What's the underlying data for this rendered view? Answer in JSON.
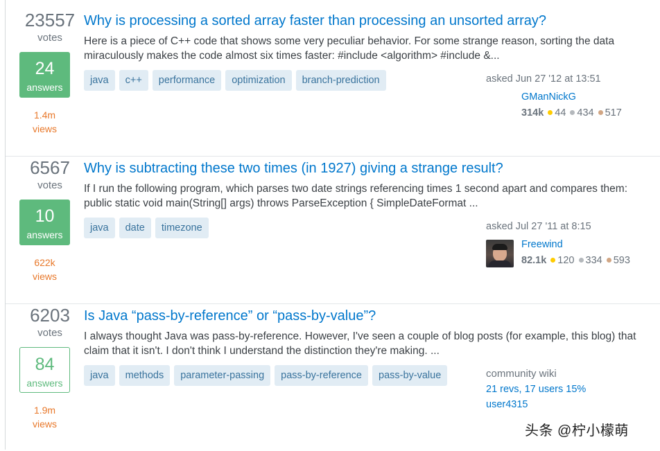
{
  "questions": [
    {
      "votes": "23557",
      "votes_label": "votes",
      "answers": "24",
      "answers_label": "answers",
      "views": "1.4m",
      "views_label": "views",
      "title": "Why is processing a sorted array faster than processing an unsorted array?",
      "excerpt": "Here is a piece of C++ code that shows some very peculiar behavior. For some strange reason, sorting the data miraculously makes the code almost six times faster: #include <algorithm> #include &...",
      "tags": [
        "java",
        "c++",
        "performance",
        "optimization",
        "branch-prediction"
      ],
      "asked": "asked Jun 27 '12 at 13:51",
      "user": "GManNickG",
      "rep": "314k",
      "gold": "44",
      "silver": "434",
      "bronze": "517"
    },
    {
      "votes": "6567",
      "votes_label": "votes",
      "answers": "10",
      "answers_label": "answers",
      "views": "622k",
      "views_label": "views",
      "title": "Why is subtracting these two times (in 1927) giving a strange result?",
      "excerpt": "If I run the following program, which parses two date strings referencing times 1 second apart and compares them: public static void main(String[] args) throws ParseException { SimpleDateFormat ...",
      "tags": [
        "java",
        "date",
        "timezone"
      ],
      "asked": "asked Jul 27 '11 at 8:15",
      "user": "Freewind",
      "rep": "82.1k",
      "gold": "120",
      "silver": "334",
      "bronze": "593"
    },
    {
      "votes": "6203",
      "votes_label": "votes",
      "answers": "84",
      "answers_label": "answers",
      "views": "1.9m",
      "views_label": "views",
      "title": "Is Java “pass-by-reference” or “pass-by-value”?",
      "excerpt": "I always thought Java was pass-by-reference. However, I've seen a couple of blog posts (for example, this blog) that claim that it isn't. I don't think I understand the distinction they're making. ...",
      "tags": [
        "java",
        "methods",
        "parameter-passing",
        "pass-by-reference",
        "pass-by-value"
      ],
      "wiki_label": "community wiki",
      "wiki_revs": "21 revs, 17 users 15%",
      "wiki_user": "user4315"
    }
  ],
  "watermark": "头条 @柠小檬萌",
  "colors": {
    "link": "#0077cc",
    "answered_green": "#5eba7d",
    "views_orange": "#e8782a",
    "tag_bg": "#e1ecf4",
    "tag_text": "#39739d"
  }
}
